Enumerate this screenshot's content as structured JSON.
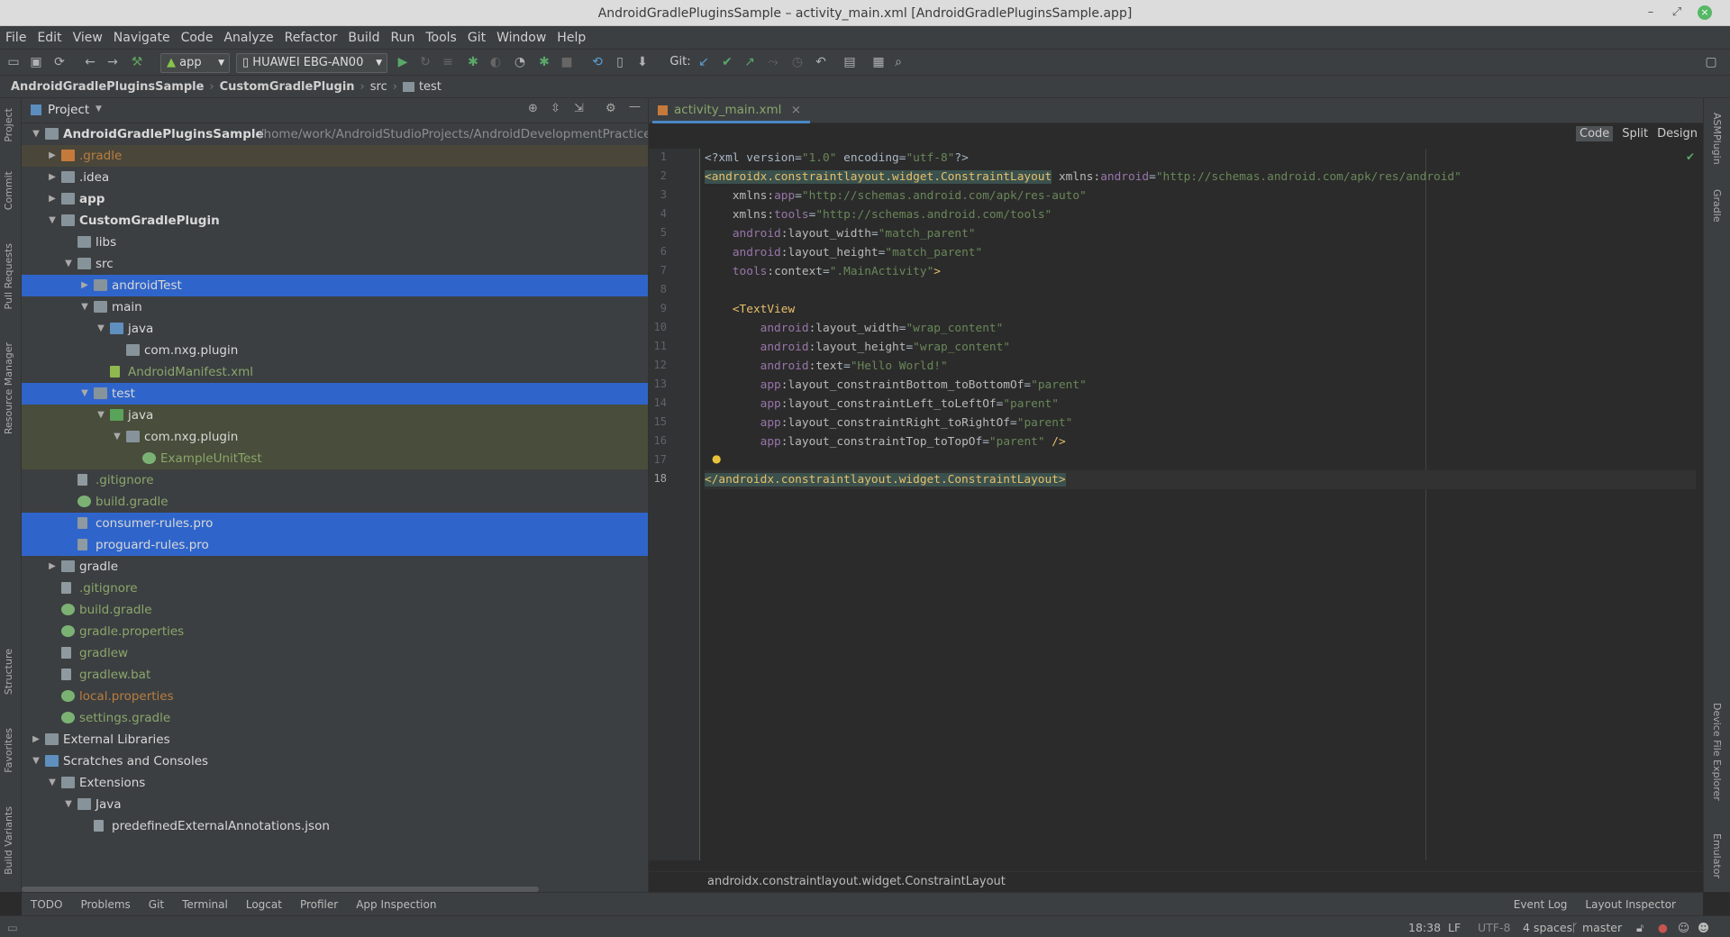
{
  "window": {
    "title": "AndroidGradlePluginsSample – activity_main.xml [AndroidGradlePluginsSample.app]"
  },
  "menu": [
    "File",
    "Edit",
    "View",
    "Navigate",
    "Code",
    "Analyze",
    "Refactor",
    "Build",
    "Run",
    "Tools",
    "Git",
    "Window",
    "Help"
  ],
  "toolbar": {
    "config": "app",
    "device": "HUAWEI EBG-AN00",
    "git_label": "Git:"
  },
  "breadcrumb": [
    "AndroidGradlePluginsSample",
    "CustomGradlePlugin",
    "src",
    "test"
  ],
  "left_strip": [
    "Project",
    "Commit",
    "Pull Requests",
    "Resource Manager",
    "Structure",
    "Favorites",
    "Build Variants"
  ],
  "right_strip": [
    "ASMPlugin",
    "Gradle",
    "Device File Explorer",
    "Emulator"
  ],
  "project": {
    "title": "Project",
    "root_path": "/home/work/AndroidStudioProjects/AndroidDevelopmentPractices/Andro",
    "tree": [
      {
        "label": "AndroidGradlePluginsSample",
        "depth": 0,
        "arrow": "open",
        "icon": "module",
        "style": "white-bold"
      },
      {
        "label": ".gradle",
        "depth": 1,
        "arrow": "closed",
        "icon": "folder-orange",
        "style": "orange",
        "bg": "yellow"
      },
      {
        "label": ".idea",
        "depth": 1,
        "arrow": "closed",
        "icon": "folder",
        "style": "white"
      },
      {
        "label": "app",
        "depth": 1,
        "arrow": "closed",
        "icon": "folder",
        "style": "white-bold"
      },
      {
        "label": "CustomGradlePlugin",
        "depth": 1,
        "arrow": "open",
        "icon": "module",
        "style": "white-bold"
      },
      {
        "label": "libs",
        "depth": 2,
        "arrow": "none",
        "icon": "folder",
        "style": "white"
      },
      {
        "label": "src",
        "depth": 2,
        "arrow": "open",
        "icon": "folder",
        "style": "white"
      },
      {
        "label": "androidTest",
        "depth": 3,
        "arrow": "closed",
        "icon": "folder",
        "style": "white",
        "bg": "sel"
      },
      {
        "label": "main",
        "depth": 3,
        "arrow": "open",
        "icon": "folder",
        "style": "white"
      },
      {
        "label": "java",
        "depth": 4,
        "arrow": "open",
        "icon": "folder-blue",
        "style": "white"
      },
      {
        "label": "com.nxg.plugin",
        "depth": 5,
        "arrow": "none",
        "icon": "folder",
        "style": "white"
      },
      {
        "label": "AndroidManifest.xml",
        "depth": 4,
        "arrow": "none",
        "icon": "xml",
        "style": "green"
      },
      {
        "label": "test",
        "depth": 3,
        "arrow": "open",
        "icon": "folder",
        "style": "white",
        "bg": "sel"
      },
      {
        "label": "java",
        "depth": 4,
        "arrow": "open",
        "icon": "folder-green",
        "style": "white",
        "bg": "hl"
      },
      {
        "label": "com.nxg.plugin",
        "depth": 5,
        "arrow": "open",
        "icon": "folder",
        "style": "white",
        "bg": "hl"
      },
      {
        "label": "ExampleUnitTest",
        "depth": 6,
        "arrow": "none",
        "icon": "class",
        "style": "green",
        "bg": "hl"
      },
      {
        "label": ".gitignore",
        "depth": 2,
        "arrow": "none",
        "icon": "file",
        "style": "green"
      },
      {
        "label": "build.gradle",
        "depth": 2,
        "arrow": "none",
        "icon": "gradle",
        "style": "green"
      },
      {
        "label": "consumer-rules.pro",
        "depth": 2,
        "arrow": "none",
        "icon": "file",
        "style": "white",
        "bg": "sel"
      },
      {
        "label": "proguard-rules.pro",
        "depth": 2,
        "arrow": "none",
        "icon": "file",
        "style": "white",
        "bg": "sel"
      },
      {
        "label": "gradle",
        "depth": 1,
        "arrow": "closed",
        "icon": "folder",
        "style": "white"
      },
      {
        "label": ".gitignore",
        "depth": 1,
        "arrow": "none",
        "icon": "file",
        "style": "green"
      },
      {
        "label": "build.gradle",
        "depth": 1,
        "arrow": "none",
        "icon": "gradle",
        "style": "green"
      },
      {
        "label": "gradle.properties",
        "depth": 1,
        "arrow": "none",
        "icon": "gradle",
        "style": "green"
      },
      {
        "label": "gradlew",
        "depth": 1,
        "arrow": "none",
        "icon": "file",
        "style": "green"
      },
      {
        "label": "gradlew.bat",
        "depth": 1,
        "arrow": "none",
        "icon": "file",
        "style": "green"
      },
      {
        "label": "local.properties",
        "depth": 1,
        "arrow": "none",
        "icon": "gradle",
        "style": "orange"
      },
      {
        "label": "settings.gradle",
        "depth": 1,
        "arrow": "none",
        "icon": "gradle",
        "style": "green"
      },
      {
        "label": "External Libraries",
        "depth": 0,
        "arrow": "closed",
        "icon": "libs",
        "style": "white"
      },
      {
        "label": "Scratches and Consoles",
        "depth": 0,
        "arrow": "open",
        "icon": "scratch",
        "style": "white"
      },
      {
        "label": "Extensions",
        "depth": 1,
        "arrow": "open",
        "icon": "folder",
        "style": "white"
      },
      {
        "label": "Java",
        "depth": 2,
        "arrow": "open",
        "icon": "folder",
        "style": "white"
      },
      {
        "label": "predefinedExternalAnnotations.json",
        "depth": 3,
        "arrow": "none",
        "icon": "file",
        "style": "white"
      }
    ]
  },
  "editor": {
    "tab": "activity_main.xml",
    "view_modes": [
      "Code",
      "Split",
      "Design"
    ],
    "current_line": 18,
    "lines": [
      [
        [
          "p",
          "<?xml version="
        ],
        [
          "s",
          "\"1.0\""
        ],
        [
          "p",
          " encoding="
        ],
        [
          "s",
          "\"utf-8\""
        ],
        [
          "p",
          "?>"
        ]
      ],
      [
        [
          "tb",
          "<androidx.constraintlayout.widget.ConstraintLayout"
        ],
        [
          "p",
          " "
        ],
        [
          "a",
          "xmlns:"
        ],
        [
          "n",
          "android"
        ],
        [
          "p",
          "="
        ],
        [
          "s",
          "\"http://schemas.android.com/apk/res/android\""
        ]
      ],
      [
        [
          "p",
          "    "
        ],
        [
          "a",
          "xmlns:"
        ],
        [
          "n",
          "app"
        ],
        [
          "p",
          "="
        ],
        [
          "s",
          "\"http://schemas.android.com/apk/res-auto\""
        ]
      ],
      [
        [
          "p",
          "    "
        ],
        [
          "a",
          "xmlns:"
        ],
        [
          "n",
          "tools"
        ],
        [
          "p",
          "="
        ],
        [
          "s",
          "\"http://schemas.android.com/tools\""
        ]
      ],
      [
        [
          "p",
          "    "
        ],
        [
          "n",
          "android"
        ],
        [
          "a",
          ":layout_width"
        ],
        [
          "p",
          "="
        ],
        [
          "s",
          "\"match_parent\""
        ]
      ],
      [
        [
          "p",
          "    "
        ],
        [
          "n",
          "android"
        ],
        [
          "a",
          ":layout_height"
        ],
        [
          "p",
          "="
        ],
        [
          "s",
          "\"match_parent\""
        ]
      ],
      [
        [
          "p",
          "    "
        ],
        [
          "n",
          "tools"
        ],
        [
          "a",
          ":context"
        ],
        [
          "p",
          "="
        ],
        [
          "s",
          "\".MainActivity\""
        ],
        [
          "t",
          ">"
        ]
      ],
      [
        [
          "p",
          ""
        ]
      ],
      [
        [
          "p",
          "    "
        ],
        [
          "t",
          "<TextView"
        ]
      ],
      [
        [
          "p",
          "        "
        ],
        [
          "n",
          "android"
        ],
        [
          "a",
          ":layout_width"
        ],
        [
          "p",
          "="
        ],
        [
          "s",
          "\"wrap_content\""
        ]
      ],
      [
        [
          "p",
          "        "
        ],
        [
          "n",
          "android"
        ],
        [
          "a",
          ":layout_height"
        ],
        [
          "p",
          "="
        ],
        [
          "s",
          "\"wrap_content\""
        ]
      ],
      [
        [
          "p",
          "        "
        ],
        [
          "n",
          "android"
        ],
        [
          "a",
          ":text"
        ],
        [
          "p",
          "="
        ],
        [
          "s",
          "\"Hello World!\""
        ]
      ],
      [
        [
          "p",
          "        "
        ],
        [
          "n",
          "app"
        ],
        [
          "a",
          ":layout_constraintBottom_toBottomOf"
        ],
        [
          "p",
          "="
        ],
        [
          "s",
          "\"parent\""
        ]
      ],
      [
        [
          "p",
          "        "
        ],
        [
          "n",
          "app"
        ],
        [
          "a",
          ":layout_constraintLeft_toLeftOf"
        ],
        [
          "p",
          "="
        ],
        [
          "s",
          "\"parent\""
        ]
      ],
      [
        [
          "p",
          "        "
        ],
        [
          "n",
          "app"
        ],
        [
          "a",
          ":layout_constraintRight_toRightOf"
        ],
        [
          "p",
          "="
        ],
        [
          "s",
          "\"parent\""
        ]
      ],
      [
        [
          "p",
          "        "
        ],
        [
          "n",
          "app"
        ],
        [
          "a",
          ":layout_constraintTop_toTopOf"
        ],
        [
          "p",
          "="
        ],
        [
          "s",
          "\"parent\""
        ],
        [
          "t",
          " />"
        ]
      ],
      [
        [
          "p",
          ""
        ]
      ],
      [
        [
          "tb",
          "</androidx.constraintlayout.widget.ConstraintLayout>"
        ]
      ]
    ],
    "breadcrumb_status": "androidx.constraintlayout.widget.ConstraintLayout"
  },
  "bottom_tools": [
    "TODO",
    "Problems",
    "Git",
    "Terminal",
    "Logcat",
    "Profiler",
    "App Inspection"
  ],
  "bottom_right_tools": [
    "Event Log",
    "Layout Inspector"
  ],
  "status": {
    "position": "18:38",
    "line_sep": "LF",
    "encoding": "UTF-8",
    "indent": "4 spaces",
    "branch": "master"
  }
}
